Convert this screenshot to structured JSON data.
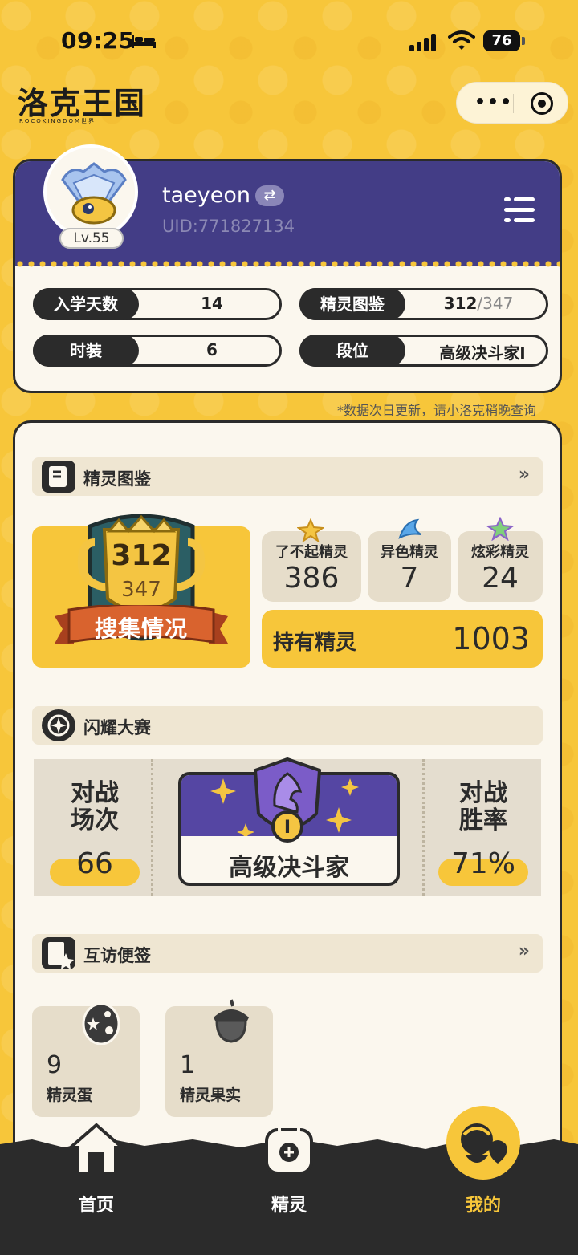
{
  "status_bar": {
    "time": "09:25",
    "battery": "76"
  },
  "app": {
    "logo": "洛克王国",
    "logo_sub": "ROCOKINGDOM世界"
  },
  "profile": {
    "username": "taeyeon",
    "switch_symbol": "⇄",
    "uid": "UID:771827134",
    "level": "Lv.55"
  },
  "stats": [
    {
      "label": "入学天数",
      "value": "14"
    },
    {
      "label": "精灵图鉴",
      "value": "312",
      "value_suffix": "/347"
    },
    {
      "label": "时装",
      "value": "6"
    },
    {
      "label": "段位",
      "value": "高级决斗家Ⅰ"
    }
  ],
  "notice": "*数据次日更新，请小洛克稍晚查询",
  "pokedex": {
    "title": "精灵图鉴",
    "more": "»",
    "collected": "312",
    "total": "347",
    "ribbon": "搜集情况",
    "cards": [
      {
        "label": "了不起精灵",
        "value": "386"
      },
      {
        "label": "异色精灵",
        "value": "7"
      },
      {
        "label": "炫彩精灵",
        "value": "24"
      }
    ],
    "owned_label": "持有精灵",
    "owned_value": "1003"
  },
  "contest": {
    "title": "闪耀大赛",
    "battles_label_1": "对战",
    "battles_label_2": "场次",
    "battles_value": "66",
    "rank": "高级决斗家",
    "rank_numeral": "Ⅰ",
    "winrate_label_1": "对战",
    "winrate_label_2": "胜率",
    "winrate_value": "71%"
  },
  "notes": {
    "title": "互访便签",
    "more": "»",
    "items": [
      {
        "value": "9",
        "label": "精灵蛋"
      },
      {
        "value": "1",
        "label": "精灵果实"
      }
    ]
  },
  "nav": [
    {
      "label": "首页",
      "active": false
    },
    {
      "label": "精灵",
      "active": false
    },
    {
      "label": "我的",
      "active": true
    }
  ],
  "colors": {
    "accent": "#f7c63a",
    "purple": "#433d86",
    "dark": "#2b2b2b",
    "card": "#fbf7ee"
  }
}
